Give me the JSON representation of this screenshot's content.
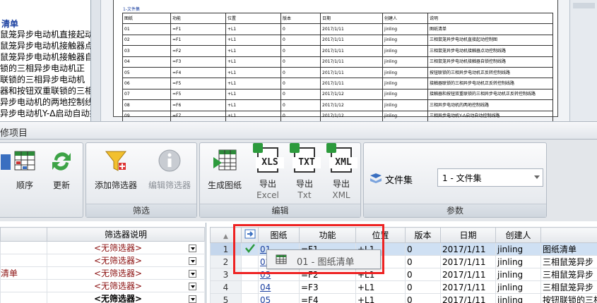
{
  "top_left": {
    "title": "清单",
    "lines": [
      "鼠笼异步电动机直接起动",
      "鼠笼异步电动机接触器点",
      "鼠笼异步电动机接触器自",
      "锁的三相异步电动机正",
      "联锁的三相异步电动机",
      "器和按钮双重联锁的三相",
      "异步电动机的两地控制线",
      "异步电动机Y-Δ启动自动控"
    ]
  },
  "preview": {
    "caption": "1-文件集",
    "headers": [
      "图纸",
      "功能",
      "位置",
      "版本",
      "日期",
      "创建人",
      "说明"
    ],
    "rows": [
      [
        "01",
        "=F1",
        "+L1",
        "0",
        "2017/1/11",
        "jinling",
        "图纸清单"
      ],
      [
        "02",
        "=F1",
        "+L1",
        "0",
        "2017/1/11",
        "jinling",
        "三相鼠笼异步电动机直接起动控制图"
      ],
      [
        "03",
        "=F2",
        "+L1",
        "0",
        "2017/1/11",
        "jinling",
        "三相鼠笼异步电动机接触器点动控制线路"
      ],
      [
        "04",
        "=F3",
        "+L1",
        "0",
        "2017/1/11",
        "jinling",
        "三相鼠笼异步电动机接触器自锁控制线路"
      ],
      [
        "05",
        "=F4",
        "+L1",
        "0",
        "2017/1/11",
        "jinling",
        "按钮联锁的三相异步电动机正反转控制线路"
      ],
      [
        "06",
        "=F5",
        "+L1",
        "0",
        "2017/1/11",
        "jinling",
        "接触器联锁的三相异步电动机正反转控制线路"
      ],
      [
        "07",
        "=F5",
        "+L1",
        "0",
        "2017/1/12",
        "jinling",
        "接触器和按钮双重联锁的三相异步电动机正反转控制线路"
      ],
      [
        "08",
        "=F6",
        "+L1",
        "0",
        "2017/1/12",
        "jinling",
        "三相异步电动机的两地控制线路"
      ],
      [
        "09",
        "=F7",
        "+L1",
        "0",
        "2017/1/12",
        "jinling",
        "三相异步电动机Y-Δ启动自动控制线路"
      ]
    ]
  },
  "section_header": "修项目",
  "ribbon": {
    "sort_label": "顺序",
    "update_label": "更新",
    "add_filter_label": "添加筛选器",
    "edit_filter_label": "编辑筛选器",
    "filter_group": "筛选",
    "generate_label": "生成图纸",
    "export_excel": [
      "导出",
      "Excel"
    ],
    "export_txt": [
      "导出",
      "Txt"
    ],
    "export_xml": [
      "导出",
      "XML"
    ],
    "edit_group": "编辑",
    "xls_text": "XLS",
    "txt_text": "TXT",
    "xml_text": "XML",
    "param_label": "文件集",
    "param_value": "1 - 文件集",
    "param_group": "参数"
  },
  "filter_panel": {
    "header": "筛选器说明",
    "rows": [
      {
        "name": "",
        "desc": "<无筛选器>"
      },
      {
        "name": "",
        "desc": "<无筛选器>"
      },
      {
        "name": "清单",
        "desc": "<无筛选器>"
      },
      {
        "name": "",
        "desc": "<无筛选器>"
      },
      {
        "name": "",
        "desc": "<无筛选器>"
      }
    ]
  },
  "grid": {
    "headers": [
      "图纸",
      "功能",
      "位置",
      "版本",
      "日期",
      "创建人",
      ""
    ],
    "rows": [
      [
        "1",
        "01",
        "=F1",
        "+L1",
        "0",
        "2017/1/11",
        "jinling",
        "图纸清单"
      ],
      [
        "2",
        "02",
        "=F1",
        "+L1",
        "0",
        "2017/1/11",
        "jinling",
        "三相鼠笼异步"
      ],
      [
        "3",
        "03",
        "=F2",
        "+L1",
        "0",
        "2017/1/11",
        "jinling",
        "三相鼠笼异步"
      ],
      [
        "4",
        "04",
        "=F3",
        "+L1",
        "0",
        "2017/1/11",
        "jinling",
        "三相鼠笼异步"
      ],
      [
        "5",
        "05",
        "=F4",
        "+L1",
        "0",
        "2017/1/11",
        "jinling",
        "按钮联锁的三相"
      ]
    ]
  },
  "tooltip": "01 - 图纸清单",
  "colors": {
    "accent": "#1a3fa0",
    "highlight": "#e22222",
    "selection": "#cfe0f3"
  }
}
